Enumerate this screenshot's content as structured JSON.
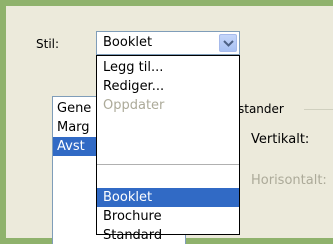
{
  "dialog": {
    "style_label": "Stil:",
    "style_combo_value": "Booklet",
    "style_list": [
      {
        "label": "Gene",
        "selected": false
      },
      {
        "label": "Marg",
        "selected": false
      },
      {
        "label": "Avst",
        "selected": true
      }
    ],
    "spacing_group_label": "stander",
    "vertical_label": "Vertikalt:",
    "horizontal_label": "Horisontalt:"
  },
  "dropdown": {
    "actions": [
      {
        "label": "Legg til...",
        "enabled": true
      },
      {
        "label": "Rediger...",
        "enabled": true
      },
      {
        "label": "Oppdater",
        "enabled": false
      }
    ],
    "styles": [
      {
        "label": "Booklet",
        "selected": true
      },
      {
        "label": "Brochure",
        "selected": false
      },
      {
        "label": "Standard",
        "selected": false
      }
    ]
  },
  "colors": {
    "selection": "#316ac5",
    "disabled_text": "#acaa99",
    "window_frame": "#8fb26c"
  }
}
